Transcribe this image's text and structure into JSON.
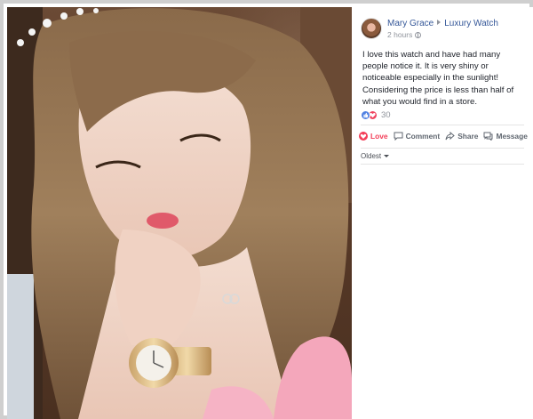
{
  "post": {
    "author": "Mary Grace",
    "group": "Luxury Watch",
    "time": "2 hours",
    "text": "I love this watch and have had many people notice it. It is very shiny or noticeable especially in the sunlight! Considering the price is less than half of what you would find in a store.",
    "reaction_count": "30"
  },
  "actions": {
    "love_label": "Love",
    "comment_label": "Comment",
    "share_label": "Share",
    "message_label": "Message"
  },
  "comments": {
    "sort_label": "Oldest"
  },
  "colors": {
    "link": "#365899",
    "love": "#f33e58",
    "like": "#4f80e1",
    "muted": "#90949c"
  }
}
